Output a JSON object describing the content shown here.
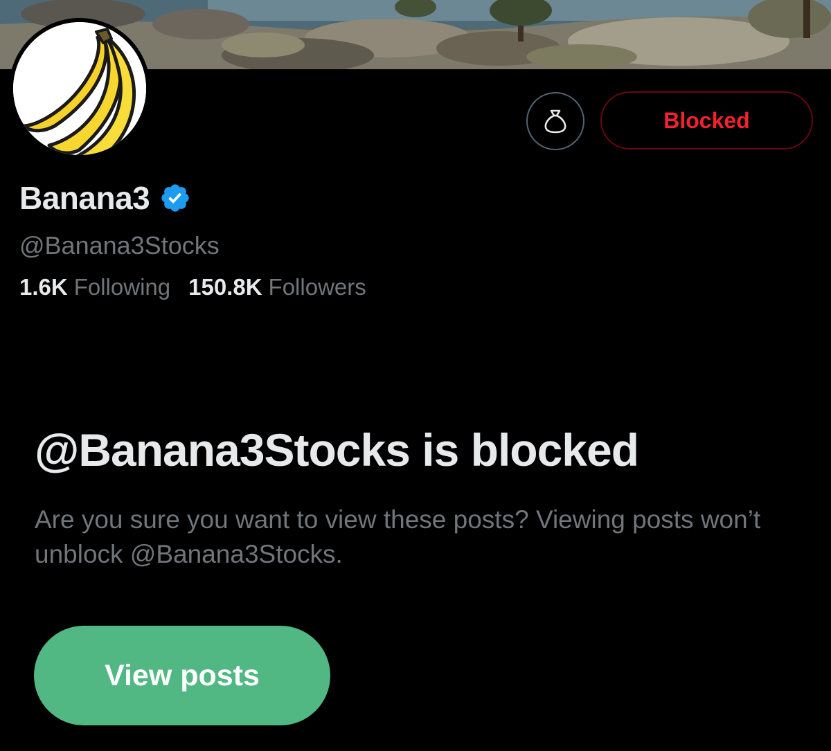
{
  "profile": {
    "display_name": "Banana3",
    "verified": true,
    "handle": "@Banana3Stocks",
    "following_count": "1.6K",
    "following_label": "Following",
    "followers_count": "150.8K",
    "followers_label": "Followers"
  },
  "actions": {
    "money_bag_icon": "money-bag-icon",
    "blocked_label": "Blocked"
  },
  "notice": {
    "title": "@Banana3Stocks is blocked",
    "description": "Are you sure you want to view these posts? Viewing posts won’t unblock @Banana3Stocks.",
    "view_posts_label": "View posts"
  },
  "colors": {
    "background": "#000000",
    "primary_text": "#e7e9ea",
    "secondary_text": "#71767b",
    "blocked_red": "#f4212e",
    "verified_blue": "#1d9bf0",
    "view_posts_green": "#52b883"
  }
}
